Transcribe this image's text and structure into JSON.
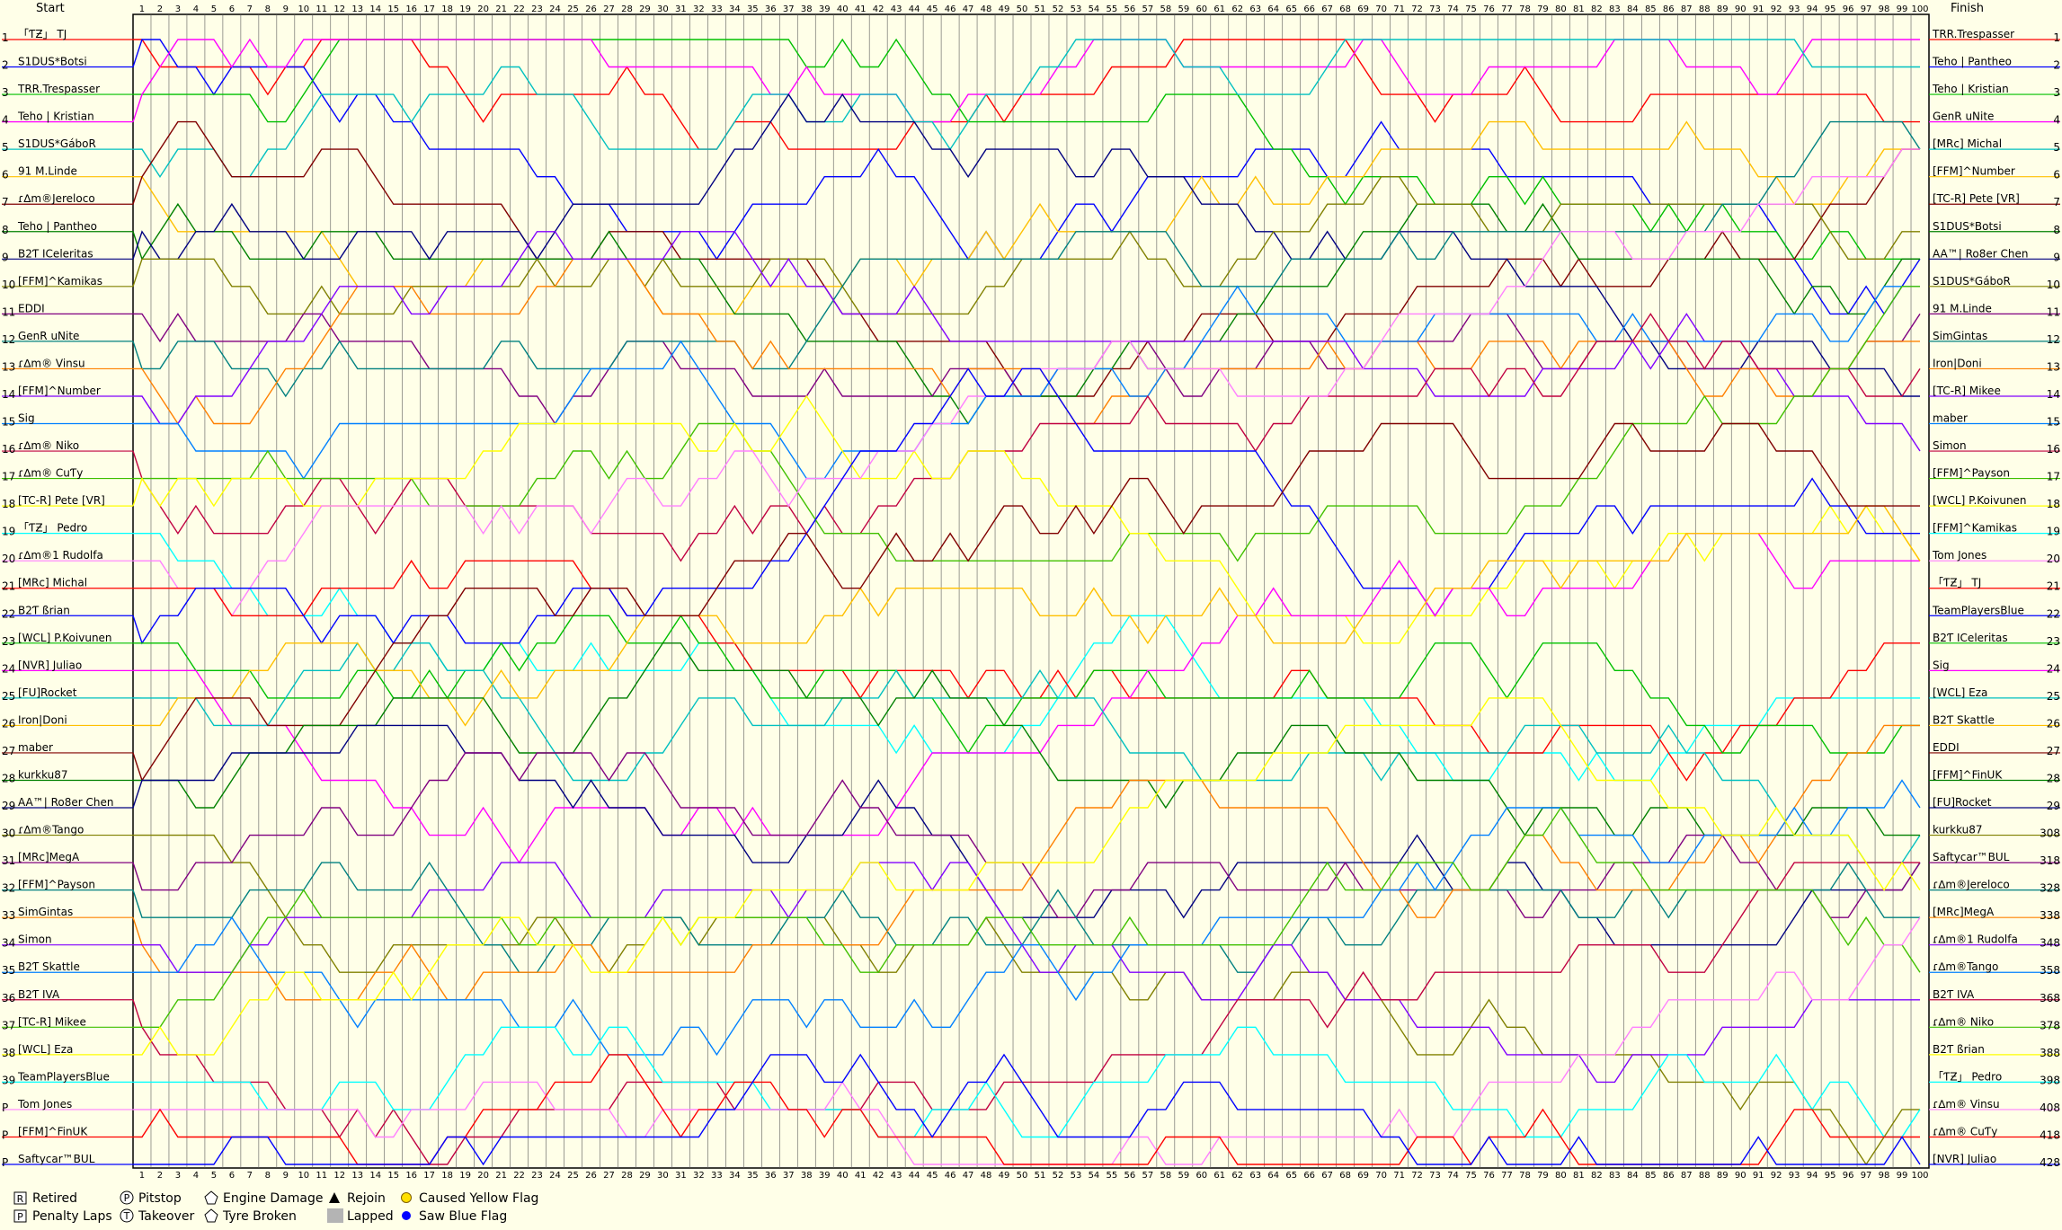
{
  "chart_data": {
    "type": "line",
    "header": {
      "start": "Start",
      "finish": "Finish"
    },
    "laps": 100,
    "start_rows": [
      {
        "pos": "1",
        "name": "「ƬƵ」 TJ"
      },
      {
        "pos": "2",
        "name": "S1DUS*Botsi"
      },
      {
        "pos": "3",
        "name": "TRR.Trespasser"
      },
      {
        "pos": "4",
        "name": "Teho | Kristian"
      },
      {
        "pos": "5",
        "name": "S1DUS*GáboR"
      },
      {
        "pos": "6",
        "name": "91 M.Linde"
      },
      {
        "pos": "7",
        "name": "ɾ∆m®Jereloco"
      },
      {
        "pos": "8",
        "name": "Teho | Pantheo"
      },
      {
        "pos": "9",
        "name": "B2Ƭ ICeleritas"
      },
      {
        "pos": "10",
        "name": "[FFM]^Kamikas"
      },
      {
        "pos": "11",
        "name": "EDDI"
      },
      {
        "pos": "12",
        "name": "GenR uNite"
      },
      {
        "pos": "13",
        "name": "ɾ∆m® Vinsu"
      },
      {
        "pos": "14",
        "name": "[FFM]^Number"
      },
      {
        "pos": "15",
        "name": "Sig"
      },
      {
        "pos": "16",
        "name": "ɾ∆m® Niko"
      },
      {
        "pos": "17",
        "name": "ɾ∆m® CuƬy"
      },
      {
        "pos": "18",
        "name": "[TC-R] Pete [VR]"
      },
      {
        "pos": "19",
        "name": "「ƬƵ」 Pedro"
      },
      {
        "pos": "20",
        "name": "ɾ∆m®1 Rudolfa"
      },
      {
        "pos": "21",
        "name": "[MRc] Michal"
      },
      {
        "pos": "22",
        "name": "B2Ƭ ßrian"
      },
      {
        "pos": "23",
        "name": "[WCL] P.Koivunen"
      },
      {
        "pos": "24",
        "name": "[NVR] Juliao"
      },
      {
        "pos": "25",
        "name": "[FU]Rocket"
      },
      {
        "pos": "26",
        "name": "Iron|Doni"
      },
      {
        "pos": "27",
        "name": "maber"
      },
      {
        "pos": "28",
        "name": "kurkku87"
      },
      {
        "pos": "29",
        "name": "AA™| Ro8er Chen"
      },
      {
        "pos": "30",
        "name": "ɾ∆m®Tango"
      },
      {
        "pos": "31",
        "name": "[MRc]MegA"
      },
      {
        "pos": "32",
        "name": "[FFM]^Payson"
      },
      {
        "pos": "33",
        "name": "SimGintas"
      },
      {
        "pos": "34",
        "name": "Simon"
      },
      {
        "pos": "35",
        "name": "B2Ƭ Skattle"
      },
      {
        "pos": "36",
        "name": "B2Ƭ IVA"
      },
      {
        "pos": "37",
        "name": "[TC-R] Mikee"
      },
      {
        "pos": "38",
        "name": "[WCL] Eza"
      },
      {
        "pos": "39",
        "name": "TeamPlayersBlue"
      },
      {
        "pos": "P",
        "name": "Tom Jones"
      },
      {
        "pos": "P",
        "name": "[FFM]^FinUK"
      },
      {
        "pos": "P",
        "name": "Saftycar™BUL"
      }
    ],
    "finish_rows": [
      {
        "pos": "1",
        "name": "TRR.Trespasser"
      },
      {
        "pos": "2",
        "name": "Teho | Pantheo"
      },
      {
        "pos": "3",
        "name": "Teho | Kristian"
      },
      {
        "pos": "4",
        "name": "GenR uNite"
      },
      {
        "pos": "5",
        "name": "[MRc] Michal"
      },
      {
        "pos": "6",
        "name": "[FFM]^Number"
      },
      {
        "pos": "7",
        "name": "[TC-R] Pete [VR]"
      },
      {
        "pos": "8",
        "name": "S1DUS*Botsi"
      },
      {
        "pos": "9",
        "name": "AA™| Ro8er Chen"
      },
      {
        "pos": "10",
        "name": "S1DUS*GáboR"
      },
      {
        "pos": "11",
        "name": "91 M.Linde"
      },
      {
        "pos": "12",
        "name": "SimGintas"
      },
      {
        "pos": "13",
        "name": "Iron|Doni"
      },
      {
        "pos": "14",
        "name": "[TC-R] Mikee"
      },
      {
        "pos": "15",
        "name": "maber"
      },
      {
        "pos": "16",
        "name": "Simon"
      },
      {
        "pos": "17",
        "name": "[FFM]^Payson"
      },
      {
        "pos": "18",
        "name": "[WCL] P.Koivunen"
      },
      {
        "pos": "19",
        "name": "[FFM]^Kamikas"
      },
      {
        "pos": "20",
        "name": "Tom Jones"
      },
      {
        "pos": "21",
        "name": "「ƬƵ」 TJ"
      },
      {
        "pos": "22",
        "name": "TeamPlayersBlue"
      },
      {
        "pos": "23",
        "name": "B2Ƭ ICeleritas"
      },
      {
        "pos": "24",
        "name": "Sig"
      },
      {
        "pos": "25",
        "name": "[WCL] Eza"
      },
      {
        "pos": "26",
        "name": "B2Ƭ Skattle"
      },
      {
        "pos": "27",
        "name": "EDDI"
      },
      {
        "pos": "28",
        "name": "[FFM]^FinUK"
      },
      {
        "pos": "29",
        "name": "[FU]Rocket"
      },
      {
        "pos": "30",
        "name": "kurkku87"
      },
      {
        "pos": "31",
        "name": "Saftycar™BUL"
      },
      {
        "pos": "32",
        "name": "ɾ∆m®Jereloco"
      },
      {
        "pos": "33",
        "name": "[MRc]MegA"
      },
      {
        "pos": "34",
        "name": "ɾ∆m®1 Rudolfa"
      },
      {
        "pos": "35",
        "name": "ɾ∆m®Tango"
      },
      {
        "pos": "36",
        "name": "B2Ƭ IVA"
      },
      {
        "pos": "37",
        "name": "ɾ∆m® Niko"
      },
      {
        "pos": "38",
        "name": "B2Ƭ ßrian"
      },
      {
        "pos": "39",
        "name": "「ƬƵ」 Pedro"
      },
      {
        "pos": "40",
        "name": "ɾ∆m® Vinsu"
      },
      {
        "pos": "41",
        "name": "ɾ∆m® CuƬy"
      },
      {
        "pos": "42",
        "name": "[NVR] Juliao"
      }
    ],
    "finish_pos_suffix": [
      "",
      "",
      "",
      "",
      "",
      "",
      "",
      "",
      "",
      "",
      "",
      "",
      "",
      "",
      "",
      "",
      "",
      "",
      "",
      "",
      "",
      "",
      "",
      "",
      "",
      "",
      "",
      "",
      "",
      "8",
      "8",
      "8",
      "8",
      "8",
      "8",
      "8",
      "8",
      "8",
      "8",
      "8",
      "8",
      "8"
    ],
    "colors": [
      "#ff0000",
      "#0000ff",
      "#00c000",
      "#ff00ff",
      "#00c0c0",
      "#ffc000",
      "#800000",
      "#008000",
      "#000080",
      "#808000",
      "#800080",
      "#008080",
      "#ff8000",
      "#8000ff",
      "#0080ff",
      "#c00040",
      "#40c000",
      "#ffff00",
      "#00ffff",
      "#ff80ff"
    ],
    "lapped_from_lap": [
      [
        16,
        34
      ],
      [
        20,
        35
      ],
      [
        30,
        27
      ],
      [
        40,
        26
      ],
      [
        46,
        23
      ],
      [
        50,
        22
      ],
      [
        55,
        20
      ],
      [
        58,
        17
      ],
      [
        60,
        14
      ],
      [
        62,
        12
      ],
      [
        65,
        9
      ],
      [
        72,
        9
      ],
      [
        75,
        21
      ],
      [
        80,
        22
      ],
      [
        85,
        21
      ],
      [
        95,
        18
      ],
      [
        98,
        18
      ]
    ],
    "legend": [
      {
        "symbol": "R",
        "label": "Retired"
      },
      {
        "symbol": "P",
        "label": "Pitstop"
      },
      {
        "symbol": "engine",
        "label": "Engine Damage"
      },
      {
        "symbol": "rejoin",
        "label": "Rejoin"
      },
      {
        "symbol": "yellow",
        "label": "Caused Yellow Flag"
      },
      {
        "symbol": "Pbox",
        "label": "Penalty Laps"
      },
      {
        "symbol": "T",
        "label": "Takeover"
      },
      {
        "symbol": "tyre",
        "label": "Tyre Broken"
      },
      {
        "symbol": "lapped",
        "label": "Lapped"
      },
      {
        "symbol": "blue",
        "label": "Saw Blue Flag"
      }
    ]
  }
}
